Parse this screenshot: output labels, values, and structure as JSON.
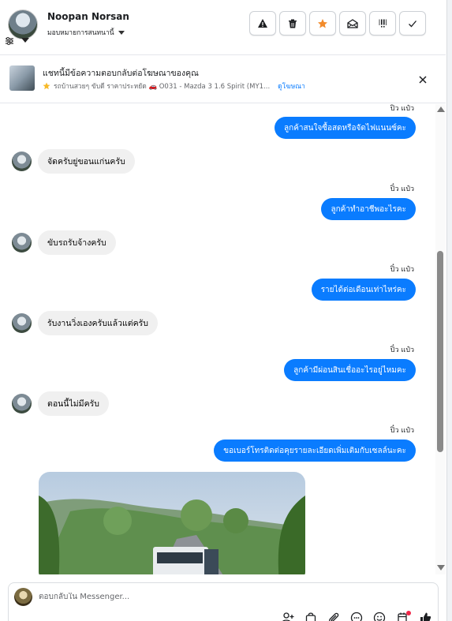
{
  "header": {
    "name": "Noopan Norsan",
    "assign_label": "มอบหมายการสนทนานี้",
    "actions": [
      {
        "icon": "warning-icon",
        "label": "Spam"
      },
      {
        "icon": "trash-icon",
        "label": "Delete"
      },
      {
        "icon": "star-icon",
        "label": "Follow up"
      },
      {
        "icon": "envelope-open-icon",
        "label": "Mark unread"
      },
      {
        "icon": "priority-icon",
        "label": "Priority"
      },
      {
        "icon": "check-icon",
        "label": "Done"
      }
    ],
    "star_color": "#f28b2b"
  },
  "ad_banner": {
    "title": "แชทนี้มีข้อความตอบกลับต่อโฆษณาของคุณ",
    "subtitle": "รถบ้านสวยๆ ขับดี ราคาประหยัด 🚗 O031 - Mazda 3 1.6 Spirit (MY1...",
    "link": "ดูโฆษณา"
  },
  "messages": [
    {
      "dir": "out",
      "sender": "ปิ๋ว แป๋ว",
      "text": "ลูกค้าสนใจซื้อสดหรือจัดไฟแนนซ์คะ"
    },
    {
      "dir": "in",
      "text": "จัดครับยู่ขอนแก่นครับ"
    },
    {
      "dir": "out",
      "sender": "ปิ๋ว แป๋ว",
      "text": "ลูกค้าทำอาชีพอะไรคะ"
    },
    {
      "dir": "in",
      "text": "ขับรถรับจ้างครับ"
    },
    {
      "dir": "out",
      "sender": "ปิ๋ว แป๋ว",
      "text": "รายได้ต่อเดือนเท่าไหร่คะ"
    },
    {
      "dir": "in",
      "text": "รับงานวิ่งเองครับแล้วแต่ครับ"
    },
    {
      "dir": "out",
      "sender": "ปิ๋ว แป๋ว",
      "text": "ลูกค้ามีผ่อนสินเชื่ออะไรอยู่ไหมคะ"
    },
    {
      "dir": "in",
      "text": "ตอนนี้ไม่มีครับ"
    },
    {
      "dir": "out",
      "sender": "ปิ๋ว แป๋ว",
      "text": "ขอเบอร์โทรติดต่อคุยรายละเอียดเพิ่มเติมกับเซลล์นะคะ"
    }
  ],
  "composer": {
    "placeholder": "ตอบกลับใน Messenger..."
  },
  "colors": {
    "outgoing_bubble": "#0a7cff",
    "incoming_bubble": "#f0f0f0",
    "notification_dot": "#f02849"
  }
}
